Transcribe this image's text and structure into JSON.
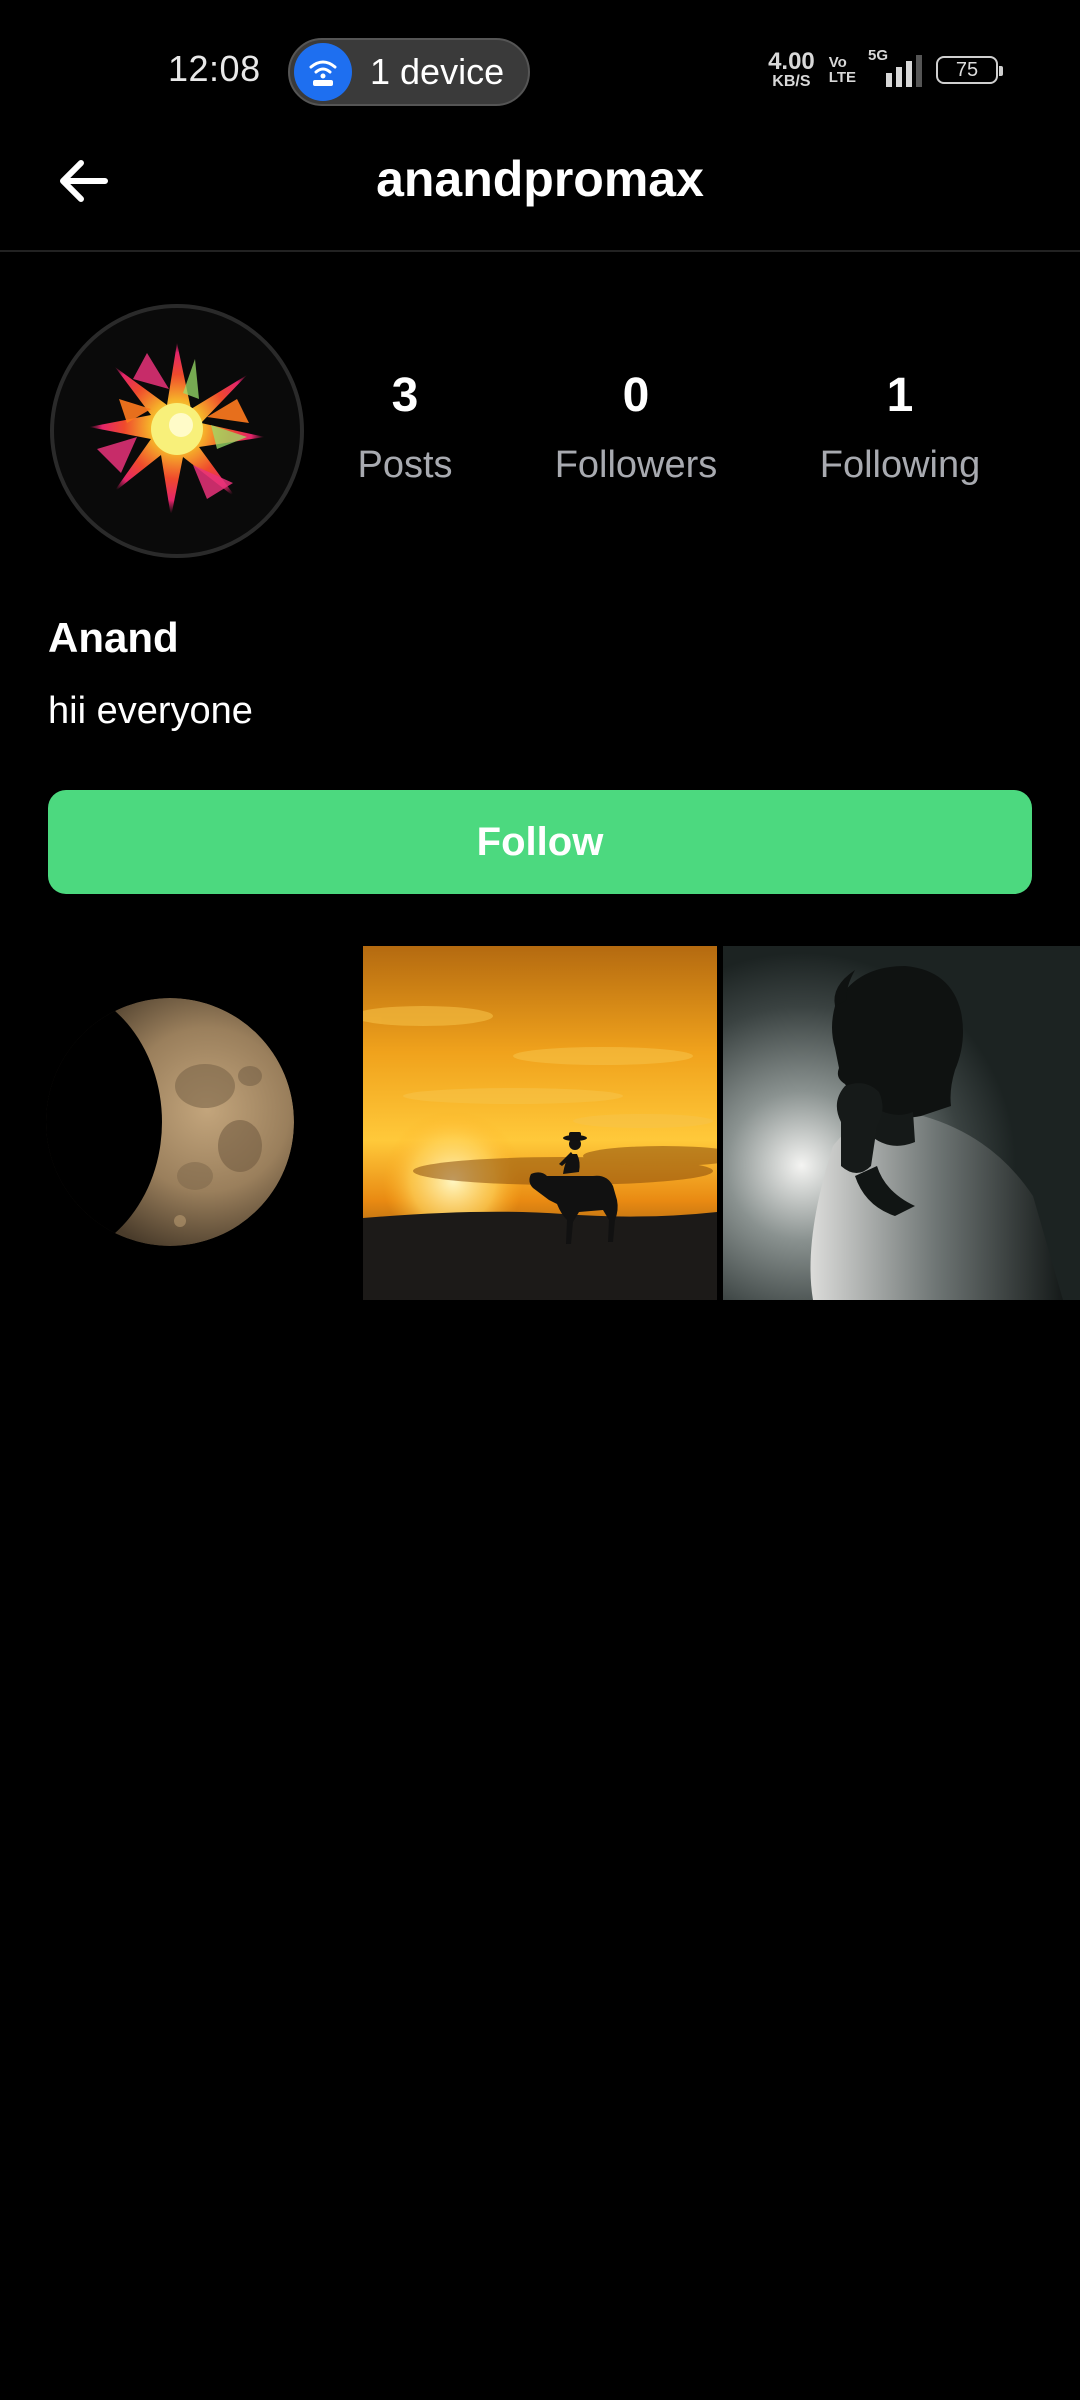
{
  "status_bar": {
    "time": "12:08",
    "hotspot_label": "1 device",
    "net_speed_value": "4.00",
    "net_speed_unit": "KB/S",
    "volte_top": "Vo",
    "volte_bottom": "LTE",
    "network_type": "5G",
    "battery": "75",
    "icons": [
      "hotspot-icon",
      "signal-icon",
      "battery-icon"
    ]
  },
  "header": {
    "title": "anandpromax",
    "back_icon": "arrow-left-icon"
  },
  "profile": {
    "stats": [
      {
        "value": "3",
        "label": "Posts"
      },
      {
        "value": "0",
        "label": "Followers"
      },
      {
        "value": "1",
        "label": "Following"
      }
    ],
    "name": "Anand",
    "bio": "hii everyone",
    "follow_label": "Follow"
  },
  "colors": {
    "background": "#000000",
    "follow_button": "#4cd97f",
    "muted_text": "#a8aab0",
    "hotspot_blue": "#1e6ff0"
  }
}
